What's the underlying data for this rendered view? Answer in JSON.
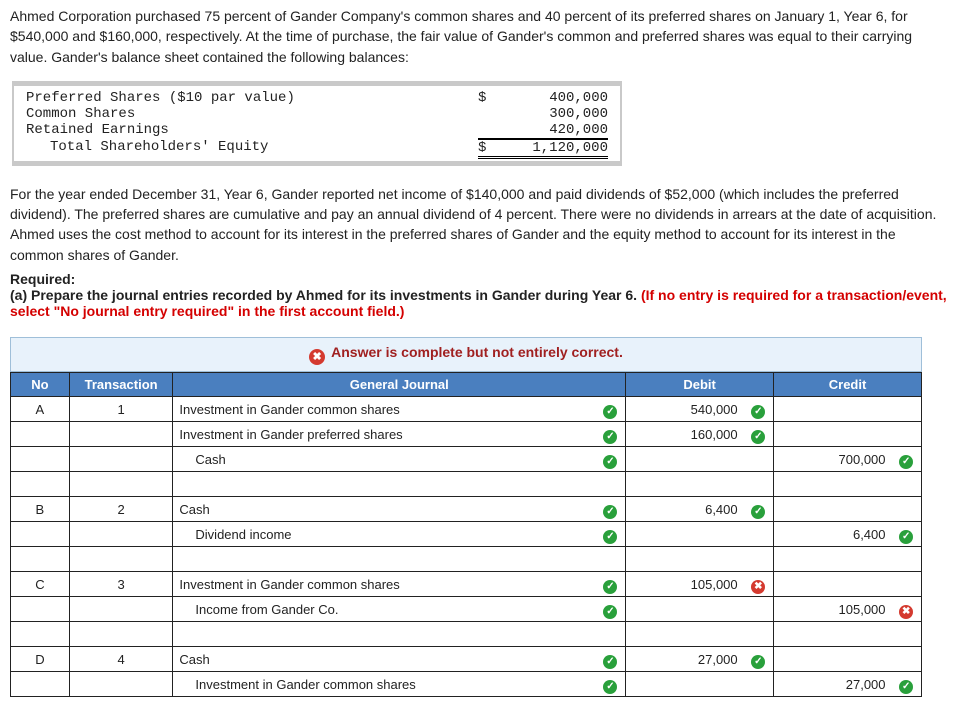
{
  "intro": {
    "p1": "Ahmed Corporation purchased 75 percent of Gander Company's common shares and 40 percent of its preferred shares on January 1, Year 6, for $540,000 and $160,000, respectively. At the time of purchase, the fair value of Gander's common and preferred shares was equal to their carrying value. Gander's balance sheet contained the following balances:",
    "p2": "For the year ended December 31, Year 6, Gander reported net income of $140,000 and paid dividends of $52,000 (which includes the preferred dividend). The preferred shares are cumulative and pay an annual dividend of 4 percent. There were no dividends in arrears at the date of acquisition. Ahmed uses the cost method to account for its interest in the preferred shares of Gander and the equity method to account for its interest in the common shares of Gander."
  },
  "required": {
    "label": "Required:",
    "a": "(a) Prepare the journal entries recorded by Ahmed for its investments in Gander during Year 6. ",
    "a_red": "(If no entry is required for a transaction/event, select \"No journal entry required\" in the first account field.)"
  },
  "balance_sheet": {
    "rows": [
      {
        "label": "Preferred Shares ($10 par value)",
        "sym": "$",
        "amt": "400,000"
      },
      {
        "label": "Common Shares",
        "sym": "",
        "amt": "300,000"
      },
      {
        "label": "Retained Earnings",
        "sym": "",
        "amt": "420,000",
        "underline": true
      },
      {
        "label": "Total Shareholders' Equity",
        "sym": "$",
        "amt": "1,120,000",
        "total": true
      }
    ]
  },
  "banner": "Answer is complete but not entirely correct.",
  "journal": {
    "headers": {
      "no": "No",
      "tr": "Transaction",
      "gj": "General Journal",
      "dr": "Debit",
      "cr": "Credit"
    },
    "rows": [
      {
        "no": "A",
        "tr": "1",
        "acct": "Investment in Gander common shares",
        "ind": 0,
        "m": "ok",
        "dr": "540,000",
        "drm": "ok",
        "cr": "",
        "crm": ""
      },
      {
        "no": "",
        "tr": "",
        "acct": "Investment in Gander preferred shares",
        "ind": 0,
        "m": "ok",
        "dr": "160,000",
        "drm": "ok",
        "cr": "",
        "crm": ""
      },
      {
        "no": "",
        "tr": "",
        "acct": "Cash",
        "ind": 1,
        "m": "ok",
        "dr": "",
        "drm": "",
        "cr": "700,000",
        "crm": "ok"
      },
      {
        "spacer": true
      },
      {
        "no": "B",
        "tr": "2",
        "acct": "Cash",
        "ind": 0,
        "m": "ok",
        "dr": "6,400",
        "drm": "ok",
        "cr": "",
        "crm": ""
      },
      {
        "no": "",
        "tr": "",
        "acct": "Dividend income",
        "ind": 1,
        "m": "ok",
        "dr": "",
        "drm": "",
        "cr": "6,400",
        "crm": "ok"
      },
      {
        "spacer": true
      },
      {
        "no": "C",
        "tr": "3",
        "acct": "Investment in Gander common shares",
        "ind": 0,
        "m": "ok",
        "dr": "105,000",
        "drm": "bad",
        "cr": "",
        "crm": ""
      },
      {
        "no": "",
        "tr": "",
        "acct": "Income from Gander Co.",
        "ind": 1,
        "m": "ok",
        "dr": "",
        "drm": "",
        "cr": "105,000",
        "crm": "bad"
      },
      {
        "spacer": true
      },
      {
        "no": "D",
        "tr": "4",
        "acct": "Cash",
        "ind": 0,
        "m": "ok",
        "dr": "27,000",
        "drm": "ok",
        "cr": "",
        "crm": ""
      },
      {
        "no": "",
        "tr": "",
        "acct": "Investment in Gander common shares",
        "ind": 1,
        "m": "ok",
        "dr": "",
        "drm": "",
        "cr": "27,000",
        "crm": "ok"
      }
    ]
  }
}
